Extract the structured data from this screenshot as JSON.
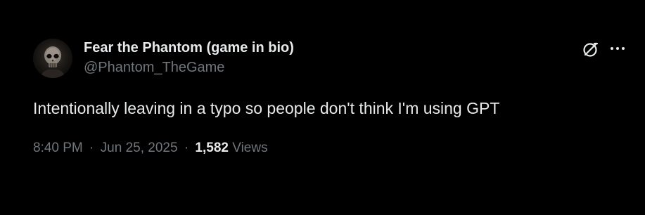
{
  "author": {
    "display_name": "Fear the Phantom (game in bio)",
    "handle": "@Phantom_TheGame",
    "avatar": "skull-avatar"
  },
  "tweet": {
    "text": "Intentionally leaving in a typo so people don't think I'm using GPT",
    "time": "8:40 PM",
    "date": "Jun 25, 2025",
    "separator": "·",
    "views_count": "1,582",
    "views_label": "Views"
  },
  "icons": {
    "grok": "grok-icon",
    "more": "more-icon"
  },
  "colors": {
    "background": "#000000",
    "primary_text": "#e7e9ea",
    "secondary_text": "#71767b"
  }
}
